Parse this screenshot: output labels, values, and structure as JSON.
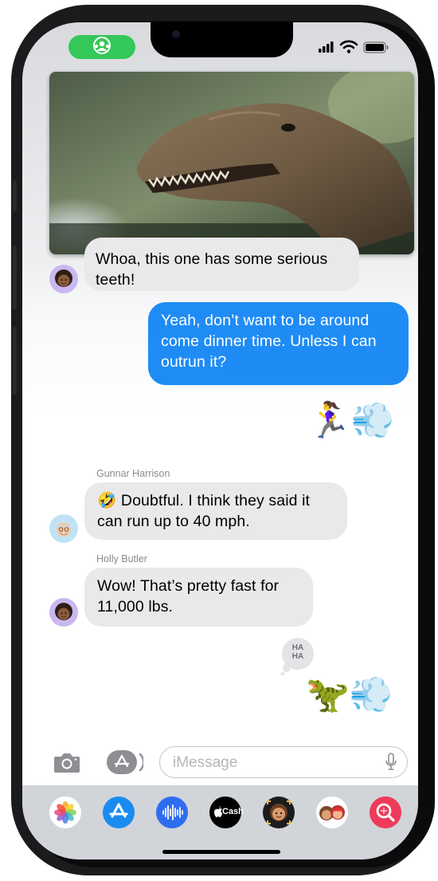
{
  "app": "Messages",
  "status_bar": {
    "shareplay_icon": "shareplay-people-icon",
    "signal_icon": "cellular-signal-icon",
    "wifi_icon": "wifi-icon",
    "battery_icon": "battery-icon"
  },
  "conversation": {
    "messages": [
      {
        "type": "received",
        "sender": "",
        "text": "Whoa, this one has some serious teeth!"
      },
      {
        "type": "sent",
        "text": "Yeah, don’t want to be around come dinner time. Unless I can outrun it?"
      },
      {
        "type": "sticker",
        "emoji": "🏃‍♀️💨"
      },
      {
        "type": "received",
        "sender": "Gunnar Harrison",
        "emoji": "🤣",
        "text": "Doubtful. I think they said it can run up to 40 mph."
      },
      {
        "type": "received",
        "sender": "Holly Butler",
        "text": "Wow! That’s pretty fast for 11,000 lbs."
      },
      {
        "type": "tapback",
        "text": "HA HA"
      },
      {
        "type": "sticker",
        "emoji": "🦖💨"
      }
    ]
  },
  "composer": {
    "placeholder": "iMessage",
    "camera_icon": "camera-icon",
    "apps_icon": "app-store-icon",
    "mic_icon": "microphone-icon"
  },
  "app_tray": {
    "items": [
      {
        "name": "Photos",
        "icon": "photos-icon"
      },
      {
        "name": "App Store",
        "icon": "app-store-icon"
      },
      {
        "name": "Audio Message",
        "icon": "audio-waveform-icon"
      },
      {
        "name": "Apple Cash",
        "label": "Cash",
        "icon": "apple-cash-icon"
      },
      {
        "name": "Memoji",
        "icon": "memoji-icon"
      },
      {
        "name": "Memoji Stickers",
        "icon": "memoji-stickers-icon"
      },
      {
        "name": "Images",
        "icon": "image-search-icon"
      }
    ]
  },
  "colors": {
    "sent_bubble": "#1f8cf5",
    "received_bubble": "#e9e9eb",
    "shareplay_green": "#34c759"
  }
}
